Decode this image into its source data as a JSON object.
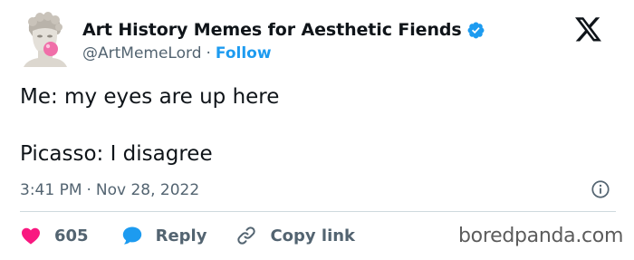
{
  "author": {
    "display_name": "Art History Memes for Aesthetic Fiends",
    "handle": "@ArtMemeLord",
    "separator": "·",
    "follow_label": "Follow",
    "verified_color": "#1d9bf0"
  },
  "tweet": {
    "lines": [
      "Me: my eyes are up here",
      "Picasso: I disagree"
    ],
    "time": "3:41 PM",
    "date": "Nov 28, 2022",
    "meta_separator": "·"
  },
  "actions": {
    "like_count": "605",
    "reply_label": "Reply",
    "copy_link_label": "Copy link"
  },
  "watermark": "boredpanda.com",
  "icons": {
    "avatar": "david-statue-bubblegum-avatar",
    "verified": "verified-badge-icon",
    "platform": "x-logo-icon",
    "info": "info-icon",
    "like": "heart-icon",
    "reply": "speech-bubble-icon",
    "copy": "link-icon"
  },
  "colors": {
    "like": "#f91880",
    "reply": "#1d9bf0",
    "link_accent": "#1d9bf0",
    "text_primary": "#0f1419",
    "text_secondary": "#536471"
  }
}
